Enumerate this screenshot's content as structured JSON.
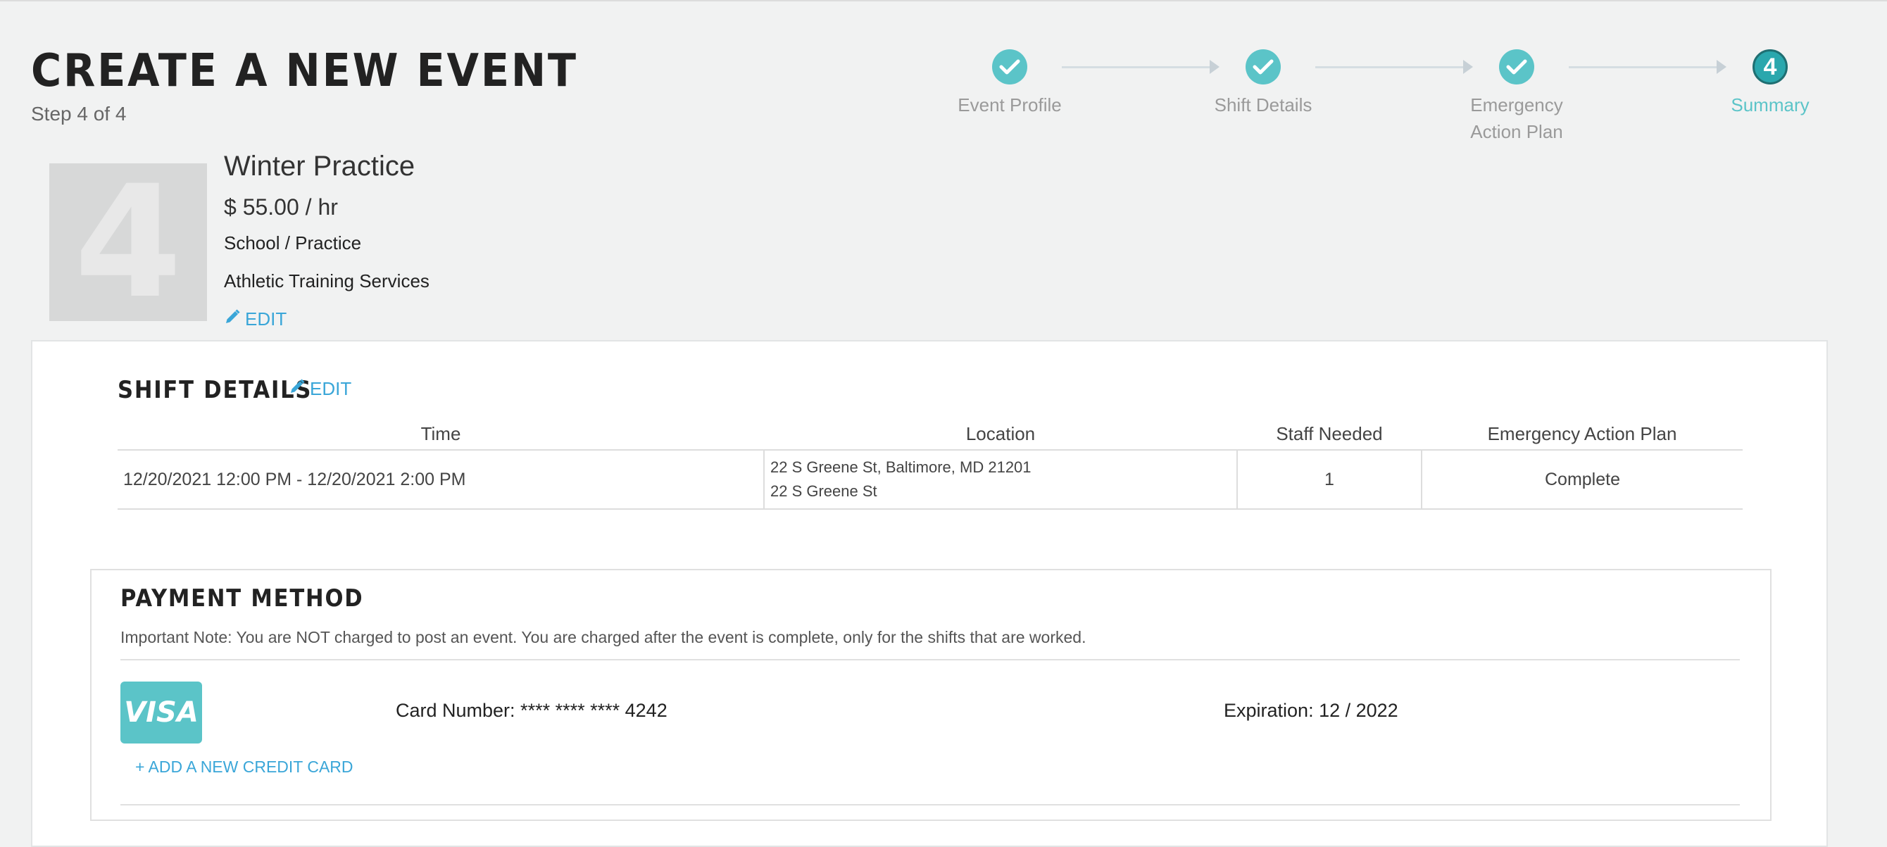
{
  "header": {
    "title": "CREATE A NEW EVENT",
    "step_label": "Step 4 of 4"
  },
  "stepper": {
    "steps": [
      {
        "label_lines": [
          "Event Profile",
          ""
        ],
        "state": "done"
      },
      {
        "label_lines": [
          "Shift Details",
          ""
        ],
        "state": "done"
      },
      {
        "label_lines": [
          "Emergency",
          "Action Plan"
        ],
        "state": "done"
      },
      {
        "label_lines": [
          "Summary",
          ""
        ],
        "state": "current",
        "number": "4"
      }
    ]
  },
  "event": {
    "thumbnail_glyph": "4",
    "name": "Winter Practice",
    "rate": "$ 55.00 / hr",
    "type": "School / Practice",
    "service": "Athletic Training Services",
    "edit_label": "EDIT"
  },
  "shift_details": {
    "title": "SHIFT DETAILS",
    "edit_label": "EDIT",
    "columns": [
      "Time",
      "Location",
      "Staff Needed",
      "Emergency Action Plan"
    ],
    "rows": [
      {
        "time": "12/20/2021 12:00 PM - 12/20/2021 2:00 PM",
        "location_line1": "22 S Greene St, Baltimore, MD 21201",
        "location_line2": "22 S Greene St",
        "staff_needed": "1",
        "eap": "Complete"
      }
    ]
  },
  "payment": {
    "title": "PAYMENT METHOD",
    "note_label": "Important Note:",
    "note_text": " You are NOT charged to post an event. You are charged after the event is complete, only for the shifts that are worked.",
    "card_brand": "VISA",
    "card_number": "Card Number: **** **** **** 4242",
    "expiration": "Expiration: 12 / 2022",
    "add_card_label": "+ ADD A NEW CREDIT CARD"
  },
  "colors": {
    "accent": "#5bc4c8",
    "link": "#3aa6d8",
    "background": "#f1f2f2"
  },
  "icons": [
    "check-icon",
    "pencil-icon"
  ]
}
